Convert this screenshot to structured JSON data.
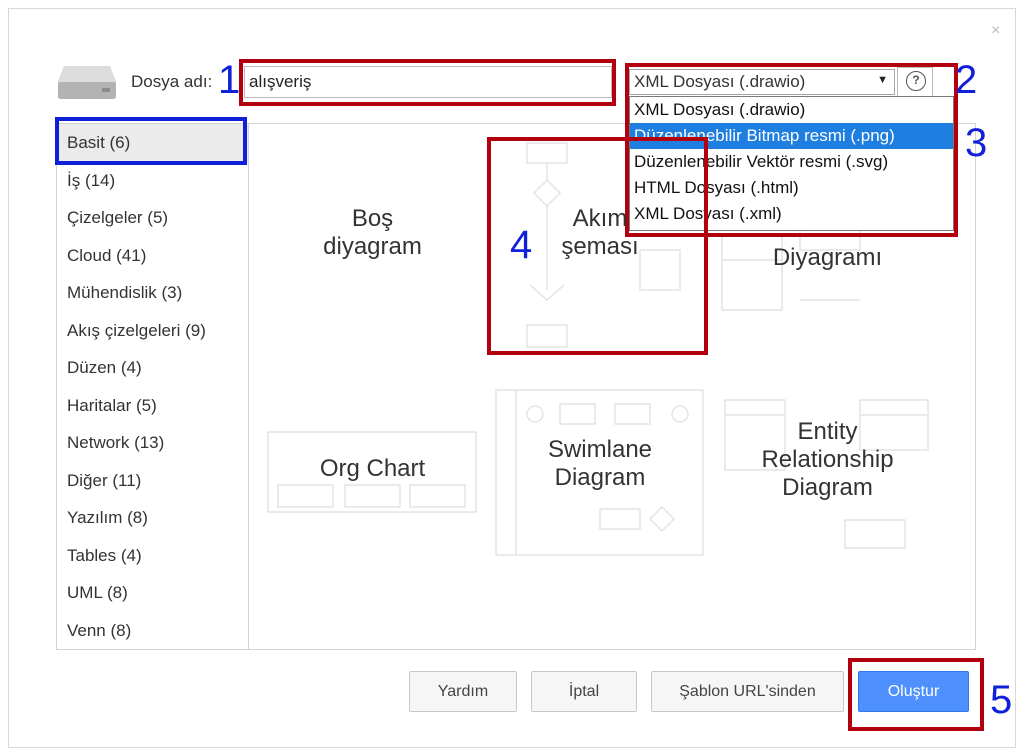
{
  "dialog": {
    "close_glyph": "×",
    "filename_label": "Dosya adı:",
    "filename_value": "alışveriş",
    "format_selected": "XML Dosyası (.drawio)",
    "format_options": [
      "XML Dosyası (.drawio)",
      "Düzenlenebilir Bitmap resmi (.png)",
      "Düzenlenebilir Vektör resmi (.svg)",
      "HTML Dosyası (.html)",
      "XML Dosyası (.xml)"
    ],
    "help_glyph": "?",
    "dropdown_caret": "▼"
  },
  "sidebar": {
    "categories": [
      "Basit (6)",
      "İş (14)",
      "Çizelgeler (5)",
      "Cloud (41)",
      "Mühendislik (3)",
      "Akış çizelgeleri (9)",
      "Düzen (4)",
      "Haritalar (5)",
      "Network (13)",
      "Diğer (11)",
      "Yazılım (8)",
      "Tables (4)",
      "UML (8)",
      "Venn (8)"
    ]
  },
  "templates": {
    "blank": [
      "Boş",
      "diyagram"
    ],
    "flowchart": [
      "Akım",
      "şeması"
    ],
    "class": [
      "Diyagramı"
    ],
    "org": [
      "Org Chart"
    ],
    "swimlane": [
      "Swimlane",
      "Diagram"
    ],
    "er": [
      "Entity",
      "Relationship",
      "Diagram"
    ]
  },
  "buttons": {
    "help": "Yardım",
    "cancel": "İptal",
    "from_url": "Şablon URL'sinden",
    "create": "Oluştur"
  },
  "annotations": {
    "n1": "1",
    "n2": "2",
    "n3": "3",
    "n4": "4",
    "n5": "5"
  },
  "colors": {
    "annotation_red": "#b3000f",
    "annotation_blue": "#1020d8",
    "primary": "#4d90fe",
    "selected_option": "#1e7fe0"
  }
}
